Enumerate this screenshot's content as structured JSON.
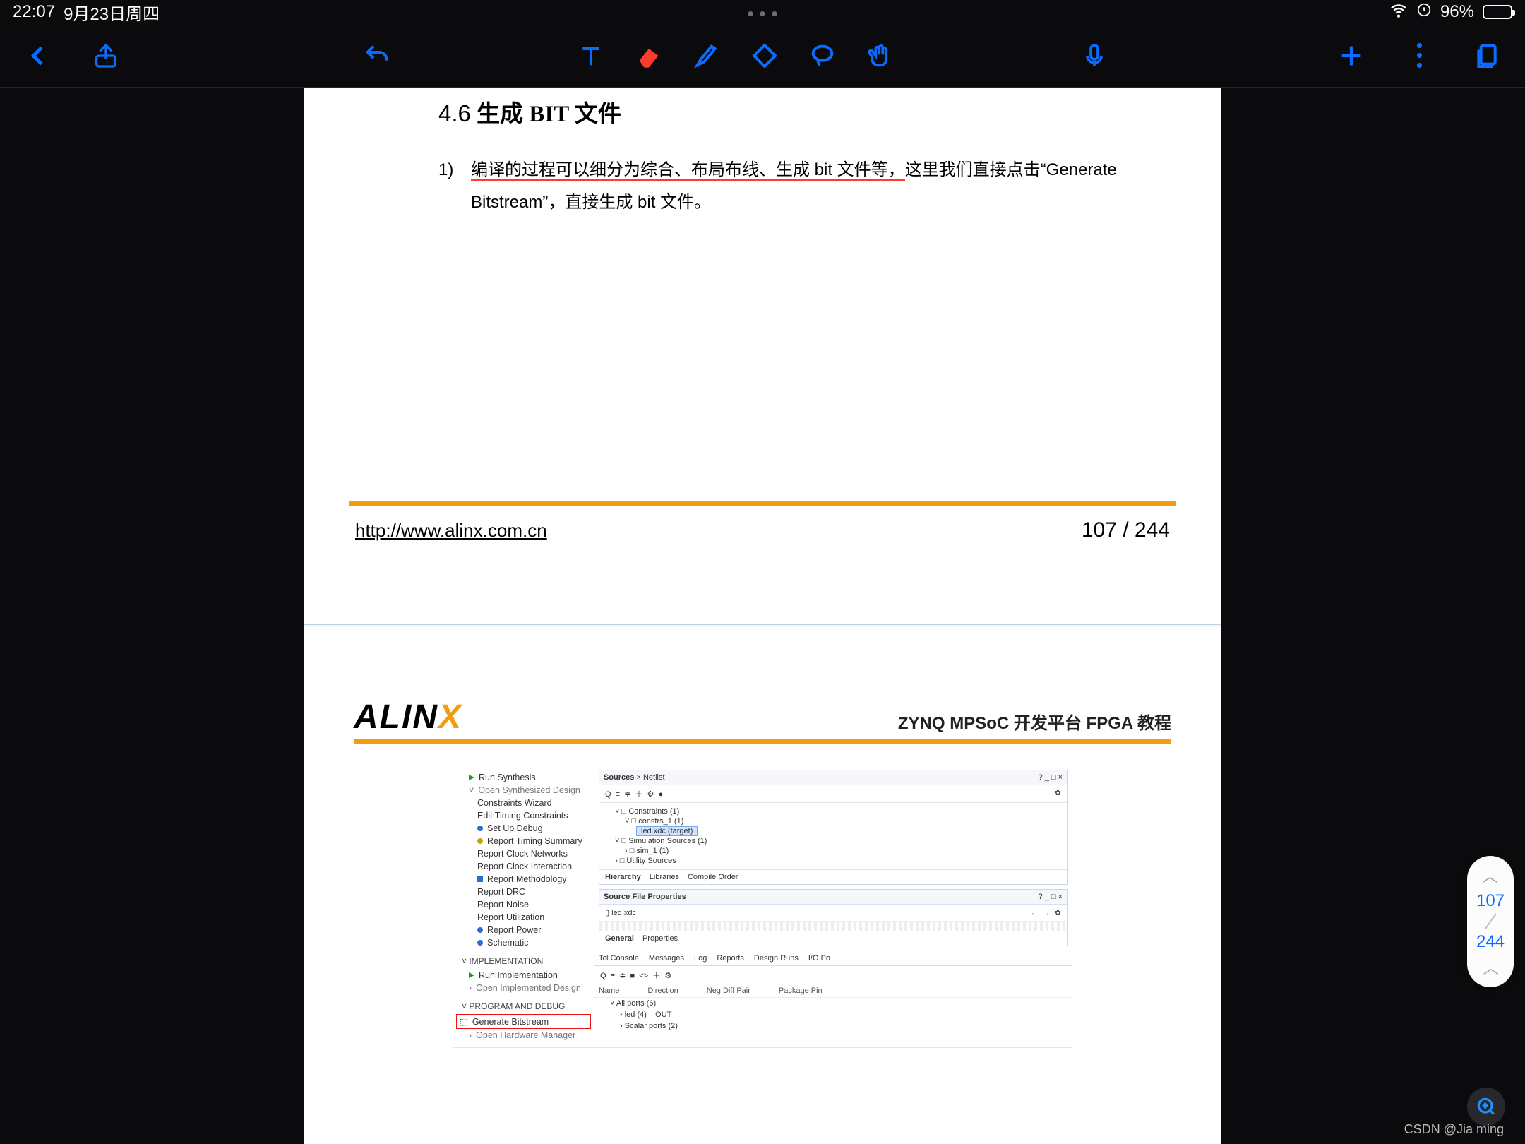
{
  "status": {
    "time": "22:07",
    "date": "9月23日周四",
    "battery_pct": "96%"
  },
  "toolbar_icons": {
    "back": "back-icon",
    "share": "share-icon",
    "undo": "undo-icon",
    "text": "text-tool-icon",
    "eraser": "eraser-icon",
    "highlighter": "highlighter-icon",
    "shape": "shape-icon",
    "lasso": "lasso-icon",
    "hand": "hand-icon",
    "mic": "mic-icon",
    "plus": "plus-icon",
    "more": "more-icon",
    "pages": "pages-icon"
  },
  "doc": {
    "heading_num": "4.6",
    "heading_text": "生成 BIT 文件",
    "li_num": "1)",
    "body_ul": "编译的过程可以细分为综合、布局布线、生成 bit 文件等，",
    "body_rest1": "这里我们直接点击“Generate",
    "body_line2": "Bitstream”，直接生成 bit 文件。",
    "footer_url": "http://www.alinx.com.cn",
    "page_num": "107 / 244",
    "logo_a": "ALIN",
    "logo_b": "X",
    "subtitle": "ZYNQ MPSoC 开发平台 FPGA 教程"
  },
  "vivado": {
    "left": {
      "items_top": [
        "Run Synthesis",
        "Open Synthesized Design",
        "Constraints Wizard",
        "Edit Timing Constraints",
        "Set Up Debug",
        "Report Timing Summary",
        "Report Clock Networks",
        "Report Clock Interaction",
        "Report Methodology",
        "Report DRC",
        "Report Noise",
        "Report Utilization",
        "Report Power",
        "Schematic"
      ],
      "cat_impl": "IMPLEMENTATION",
      "impl_items": [
        "Run Implementation",
        "Open Implemented Design"
      ],
      "cat_prog": "PROGRAM AND DEBUG",
      "gen": "Generate Bitstream",
      "open_hw": "Open Hardware Manager"
    },
    "right": {
      "sources_title": "Sources",
      "netlist": "Netlist",
      "win_ctrl": "?  _  □  ×",
      "constraints": "Constraints (1)",
      "constrs": "constrs_1 (1)",
      "led": "led.xdc (target)",
      "simsrc": "Simulation Sources (1)",
      "sim": "sim_1 (1)",
      "util": "Utility Sources",
      "tab_h": "Hierarchy",
      "tab_l": "Libraries",
      "tab_c": "Compile Order",
      "props_title": "Source File Properties",
      "props_file": "led.xdc",
      "props_tab_g": "General",
      "props_tab_p": "Properties",
      "btabs": [
        "Tcl Console",
        "Messages",
        "Log",
        "Reports",
        "Design Runs",
        "I/O Po"
      ],
      "th": [
        "Name",
        "Direction",
        "Neg Diff Pair",
        "Package Pin"
      ],
      "row_all": "All ports (6)",
      "row_led": "led (4)",
      "row_led_dir": "OUT",
      "row_sc": "Scalar ports (2)"
    }
  },
  "indicator": {
    "cur": "107",
    "tot": "244"
  },
  "watermark": "CSDN @Jia ming"
}
